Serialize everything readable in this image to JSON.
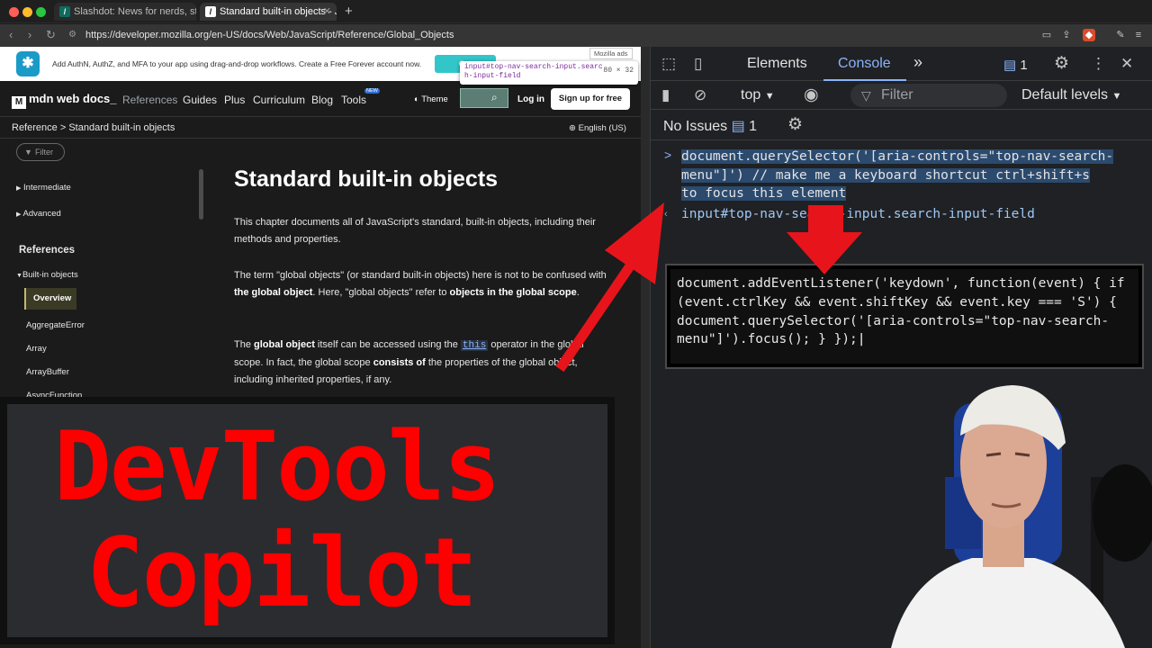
{
  "browser": {
    "tabs": [
      {
        "title": "Slashdot: News for nerds, stuff th",
        "favicon": "slashdot-icon"
      },
      {
        "title": "Standard built-in objects - Ja",
        "favicon": "mdn-icon"
      }
    ],
    "new_tab": "+",
    "url": "https://developer.mozilla.org/en-US/docs/Web/JavaScript/Reference/Global_Objects"
  },
  "ad": {
    "text": "Add AuthN, AuthZ, and MFA to your app using drag-and-drop workflows. Create a Free Forever account now.",
    "button": "Get",
    "badge": "Mozilla ads"
  },
  "inspect_tooltip": {
    "selector_line1": "input#top-nav-search-input.searc",
    "selector_line2": "h-input-field",
    "dims": "80 × 32"
  },
  "mdn": {
    "logo": "mdn web docs_",
    "nav": [
      "References",
      "Guides",
      "Plus",
      "Curriculum",
      "Blog",
      "Tools"
    ],
    "new_badge": "NEW",
    "theme": "Theme",
    "login": "Log in",
    "signup": "Sign up for free",
    "breadcrumbs": [
      "Reference",
      "Standard built-in objects"
    ],
    "crumb_sep": ">",
    "language": "English (US)",
    "filter": "Filter"
  },
  "sidebar": {
    "intermediate": "Intermediate",
    "advanced": "Advanced",
    "references": "References",
    "builtins": "Built-in objects",
    "overview": "Overview",
    "items": [
      "AggregateError",
      "Array",
      "ArrayBuffer",
      "AsyncFunction"
    ]
  },
  "article": {
    "title": "Standard built-in objects",
    "p1": "This chapter documents all of JavaScript's standard, built-in objects, including their methods and properties.",
    "p2_a": "The term \"global objects\" (or standard built-in objects) here is not to be confused with ",
    "p2_b": "the global object",
    "p2_c": ". Here, \"global objects\" refer to ",
    "p2_d": "objects in the global scope",
    "p2_e": ".",
    "p3_a": "The ",
    "p3_b": "global object",
    "p3_c": " itself can be accessed using the ",
    "p3_code": "this",
    "p3_d": " operator in the global scope. In fact, the global scope ",
    "p3_e": "consists of",
    "p3_f": " the properties of the global object, including inherited properties, if any."
  },
  "overlay": {
    "line1": "DevTools",
    "line2": "Copilot"
  },
  "devtools": {
    "tabs": [
      "Elements",
      "Console"
    ],
    "more": "»",
    "message_count": "1",
    "context": "top",
    "filter_placeholder": "Filter",
    "levels": "Default levels",
    "no_issues": "No Issues",
    "issues_count": "1",
    "prompt": ">",
    "input_line1": "document.querySelector('[aria-controls=\"top-nav-search-",
    "input_line2": "menu\"]') // make me a keyboard shortcut ctrl+shift+s",
    "input_line3": "to focus this element",
    "result": "input#top-nav-search-input.search-input-field",
    "answer_code": "document.addEventListener('keydown', function(event) { if (event.ctrlKey && event.shiftKey && event.key === 'S') { document.querySelector('[aria-controls=\"top-nav-search-menu\"]').focus(); } });"
  },
  "colors": {
    "arrow": "#e8141b",
    "overlay_text": "#ff0000",
    "accent": "#8ab4f8"
  }
}
